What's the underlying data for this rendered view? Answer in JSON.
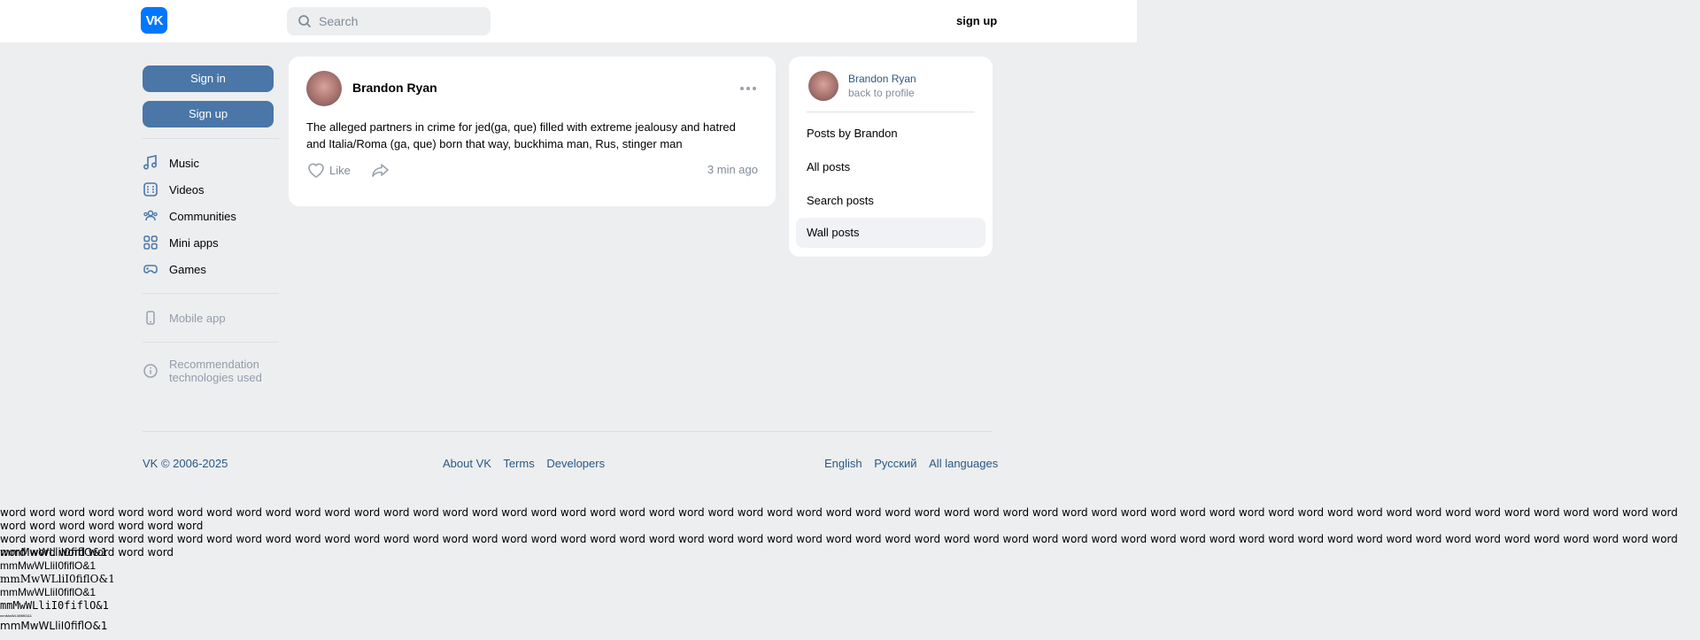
{
  "header": {
    "logo_text": "VK",
    "search_placeholder": "Search",
    "signup_label": "sign up"
  },
  "sidebar": {
    "signin_label": "Sign in",
    "signup_label": "Sign up",
    "items": [
      {
        "label": "Music",
        "icon": "music-icon"
      },
      {
        "label": "Videos",
        "icon": "video-icon"
      },
      {
        "label": "Communities",
        "icon": "communities-icon"
      },
      {
        "label": "Mini apps",
        "icon": "mini-apps-icon"
      },
      {
        "label": "Games",
        "icon": "games-icon"
      }
    ],
    "mobile_app": "Mobile app",
    "recommendation_line1": "Recommendation",
    "recommendation_line2": "technologies used"
  },
  "post": {
    "author": "Brandon Ryan",
    "text": "The alleged partners in crime for jed(ga, que) filled with extreme jealousy and hatred and Italia/Roma (ga, que) born that way, buckhima man, Rus, stinger man",
    "like_label": "Like",
    "time": "3 min ago"
  },
  "right_panel": {
    "name": "Brandon Ryan",
    "back_label": "back to profile",
    "items": [
      "Posts by Brandon",
      "All posts",
      "Search posts",
      "Wall posts"
    ],
    "active_item": "Wall posts"
  },
  "footer": {
    "copyright": "VK © 2006-2025",
    "links": [
      "About VK",
      "Terms",
      "Developers"
    ],
    "languages": [
      "English",
      "Русский",
      "All languages"
    ]
  },
  "test_text": {
    "words_line1": "word word word word word word word word word word word word word word word word word word word word word word word word word word word word word word word word word word word word word word word word word word word word word word word word word word word word word word word word word word word word word word word word",
    "words_line2": "word word word word word word word word word word word word word word word word word word word word word word word word word word word word word word word word word word word word word word word word word word word word word word word word word word word word word word word word word word word word word word word",
    "sample": "mmMwWLliI0fiflO&1"
  },
  "colors": {
    "accent": "#4a76a8",
    "link": "#2a5885",
    "background": "#edeef0",
    "brand": "#0077ff"
  }
}
